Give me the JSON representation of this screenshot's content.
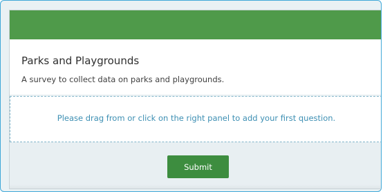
{
  "form": {
    "title": "Parks and Playgrounds",
    "description": "A survey to collect data on parks and playgrounds."
  },
  "drop_zone": {
    "hint": "Please drag from or click on the right panel to add your first question."
  },
  "actions": {
    "submit_label": "Submit"
  },
  "colors": {
    "header_green": "#4f9a4a",
    "button_green": "#3d8d3f",
    "hint_blue": "#3d8fb3",
    "frame_border": "#3fa8d8"
  }
}
